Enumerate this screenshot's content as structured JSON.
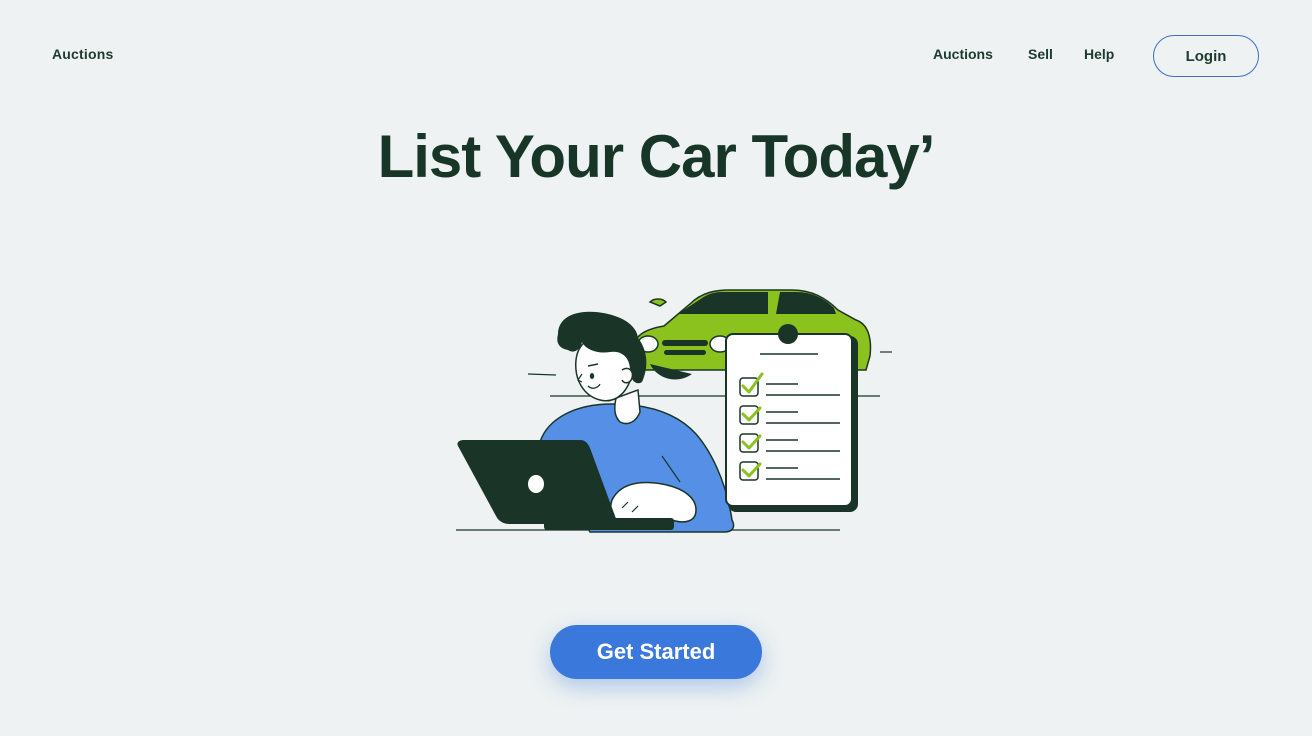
{
  "nav": {
    "brand": "Auctions",
    "links": {
      "auctions": "Auctions",
      "sell": "Sell",
      "help": "Help"
    },
    "login_label": "Login"
  },
  "hero": {
    "title": "List Your Car Today’"
  },
  "cta": {
    "label": "Get Started"
  },
  "colors": {
    "background": "#eef2f2",
    "heading": "#173628",
    "accent_blue": "#3b78db",
    "car_green": "#8cc21e",
    "dark_green": "#1a3528"
  },
  "illustration": {
    "icons": [
      "person-icon",
      "laptop-icon",
      "car-icon",
      "checklist-icon"
    ]
  }
}
